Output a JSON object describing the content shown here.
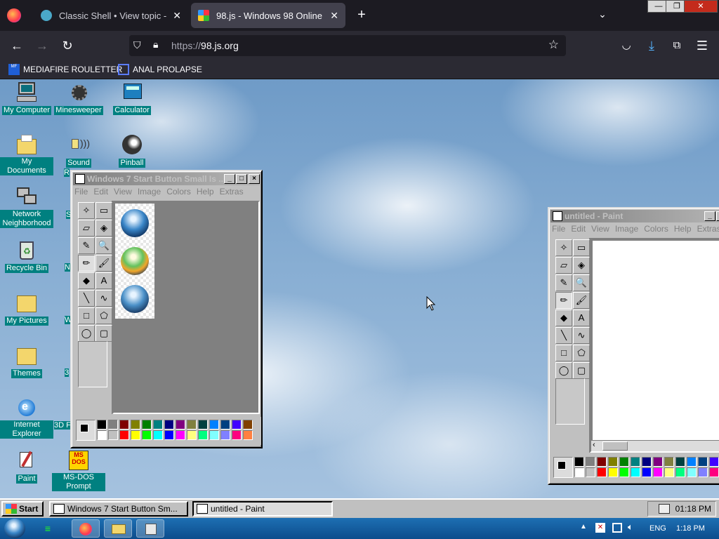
{
  "browser": {
    "tabs": [
      {
        "title": "Classic Shell • View topic - Start"
      },
      {
        "title": "98.js - Windows 98 Online"
      }
    ],
    "new_tab": "+",
    "url_scheme": "https://",
    "url_host": "98.js.org",
    "bookmarks": [
      "MEDIAFIRE ROULETTER",
      "ANAL PROLAPSE"
    ],
    "window_controls": [
      "—",
      "❐",
      "✕"
    ]
  },
  "desktop": {
    "icons_col1": [
      {
        "label": "My Computer",
        "icon": "computer-icon"
      },
      {
        "label": "My Documents",
        "icon": "folder-icon"
      },
      {
        "label": "Network Neighborhood",
        "icon": "network-icon"
      },
      {
        "label": "Recycle Bin",
        "icon": "recycle-bin-icon"
      },
      {
        "label": "My Pictures",
        "icon": "folder-icon"
      },
      {
        "label": "Themes",
        "icon": "folder-icon"
      },
      {
        "label": "Internet Explorer",
        "icon": "ie-icon"
      },
      {
        "label": "Paint",
        "icon": "paint-icon"
      }
    ],
    "icons_col2": [
      {
        "label": "Minesweeper",
        "icon": "minesweeper-icon"
      },
      {
        "label": "Sound",
        "icon": "sound-icon"
      },
      {
        "label": "MS-DOS Prompt",
        "icon": "msdos-icon"
      }
    ],
    "icons_col2_partial": [
      "R",
      "S",
      "N",
      "W",
      "3",
      "3D F"
    ],
    "icons_col3": [
      {
        "label": "Calculator",
        "icon": "calculator-icon"
      },
      {
        "label": "Pinball",
        "icon": "pinball-icon"
      }
    ]
  },
  "paint1": {
    "title": "Windows 7 Start Button Small Is ...",
    "menu": [
      "File",
      "Edit",
      "View",
      "Image",
      "Colors",
      "Help",
      "Extras"
    ]
  },
  "paint2": {
    "title": "untitled - Paint",
    "menu": [
      "File",
      "Edit",
      "View",
      "Image",
      "Colors",
      "Help",
      "Extras"
    ]
  },
  "tools": [
    "✧",
    "▭",
    "▱",
    "◈",
    "✎",
    "🔍",
    "✏",
    "🖌",
    "◆",
    "A",
    "╲",
    "∿",
    "□",
    "⬠",
    "◯",
    "▢"
  ],
  "palette_top": [
    "#000000",
    "#808080",
    "#800000",
    "#808000",
    "#008000",
    "#008080",
    "#000080",
    "#800080",
    "#808040",
    "#004040",
    "#0080ff",
    "#004080",
    "#4000ff",
    "#804000"
  ],
  "palette_bottom": [
    "#ffffff",
    "#c0c0c0",
    "#ff0000",
    "#ffff00",
    "#00ff00",
    "#00ffff",
    "#0000ff",
    "#ff00ff",
    "#ffff80",
    "#00ff80",
    "#80ffff",
    "#8080ff",
    "#ff0080",
    "#ff8040"
  ],
  "taskbar98": {
    "start": "Start",
    "buttons": [
      "Windows 7 Start Button Sm...",
      "untitled - Paint"
    ],
    "clock": "01:18 PM"
  },
  "host_taskbar": {
    "lang": "ENG",
    "time": "1:18 PM"
  }
}
